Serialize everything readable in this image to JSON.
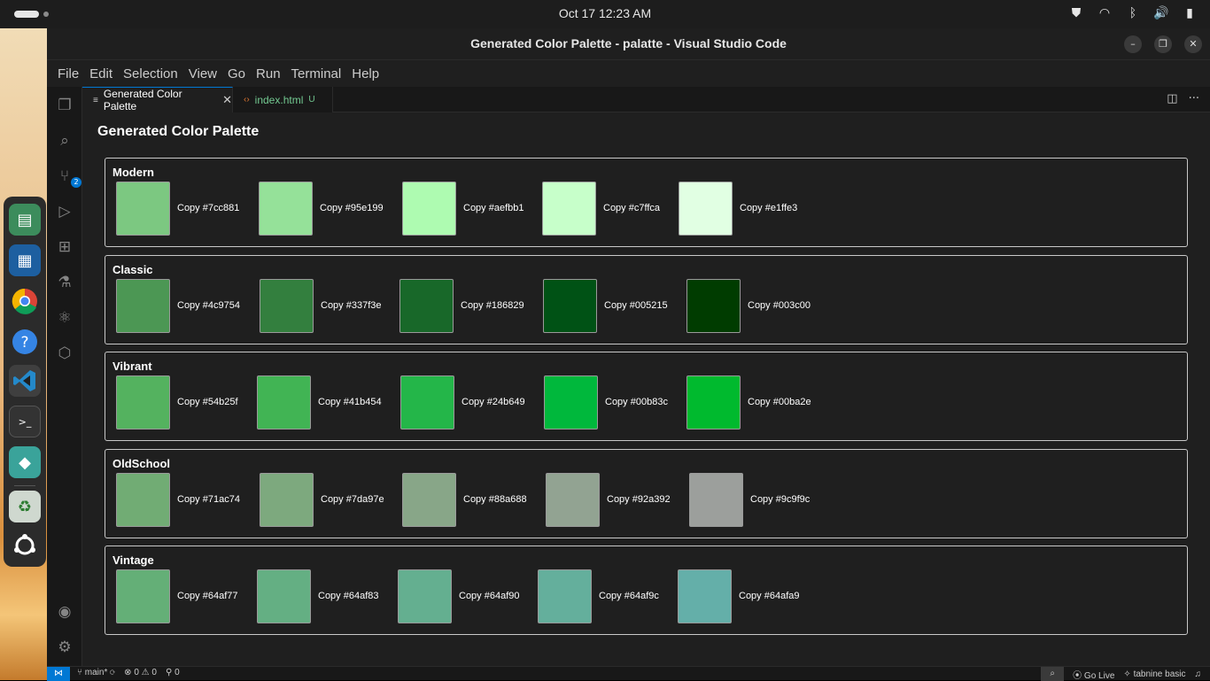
{
  "topbar": {
    "clock": "Oct 17  12:23 AM",
    "tray_icons": [
      "shield-icon",
      "wifi-icon",
      "bluetooth-icon",
      "volume-icon",
      "battery-icon"
    ]
  },
  "dock": {
    "items": [
      "files-icon",
      "document-viewer-icon",
      "chrome-icon",
      "help-icon",
      "vscode-icon",
      "terminal-icon",
      "app-store-icon",
      "trash-icon",
      "ubuntu-icon"
    ]
  },
  "window": {
    "title": "Generated Color Palette - palatte - Visual Studio Code",
    "minimize": "–",
    "maximize": "❐",
    "close": "✕"
  },
  "menu": [
    "File",
    "Edit",
    "Selection",
    "View",
    "Go",
    "Run",
    "Terminal",
    "Help"
  ],
  "activity": {
    "source_control_badge": "2"
  },
  "tabs": [
    {
      "label": "Generated Color Palette",
      "icon": "≡",
      "close": "✕"
    },
    {
      "label": "index.html",
      "icon": "‹›",
      "status": "U"
    }
  ],
  "page": {
    "title": "Generated Color Palette",
    "groups": [
      {
        "name": "Modern",
        "colors": [
          {
            "hex": "#7cc881",
            "label": "Copy #7cc881"
          },
          {
            "hex": "#95e199",
            "label": "Copy #95e199"
          },
          {
            "hex": "#aefbb1",
            "label": "Copy #aefbb1"
          },
          {
            "hex": "#c7ffca",
            "label": "Copy #c7ffca"
          },
          {
            "hex": "#e1ffe3",
            "label": "Copy #e1ffe3"
          }
        ]
      },
      {
        "name": "Classic",
        "colors": [
          {
            "hex": "#4c9754",
            "label": "Copy #4c9754"
          },
          {
            "hex": "#337f3e",
            "label": "Copy #337f3e"
          },
          {
            "hex": "#186829",
            "label": "Copy #186829"
          },
          {
            "hex": "#005215",
            "label": "Copy #005215"
          },
          {
            "hex": "#003c00",
            "label": "Copy #003c00"
          }
        ]
      },
      {
        "name": "Vibrant",
        "colors": [
          {
            "hex": "#54b25f",
            "label": "Copy #54b25f"
          },
          {
            "hex": "#41b454",
            "label": "Copy #41b454"
          },
          {
            "hex": "#24b649",
            "label": "Copy #24b649"
          },
          {
            "hex": "#00b83c",
            "label": "Copy #00b83c"
          },
          {
            "hex": "#00ba2e",
            "label": "Copy #00ba2e"
          }
        ]
      },
      {
        "name": "OldSchool",
        "colors": [
          {
            "hex": "#71ac74",
            "label": "Copy #71ac74"
          },
          {
            "hex": "#7da97e",
            "label": "Copy #7da97e"
          },
          {
            "hex": "#88a688",
            "label": "Copy #88a688"
          },
          {
            "hex": "#92a392",
            "label": "Copy #92a392"
          },
          {
            "hex": "#9c9f9c",
            "label": "Copy #9c9f9c"
          }
        ]
      },
      {
        "name": "Vintage",
        "colors": [
          {
            "hex": "#64af77",
            "label": "Copy #64af77"
          },
          {
            "hex": "#64af83",
            "label": "Copy #64af83"
          },
          {
            "hex": "#64af90",
            "label": "Copy #64af90"
          },
          {
            "hex": "#64af9c",
            "label": "Copy #64af9c"
          },
          {
            "hex": "#64afa9",
            "label": "Copy #64afa9"
          }
        ]
      }
    ]
  },
  "status": {
    "branch": "main*",
    "errors": "0",
    "warnings": "0",
    "ports": "0",
    "go_live": "Go Live",
    "tabnine": "tabnine basic"
  }
}
